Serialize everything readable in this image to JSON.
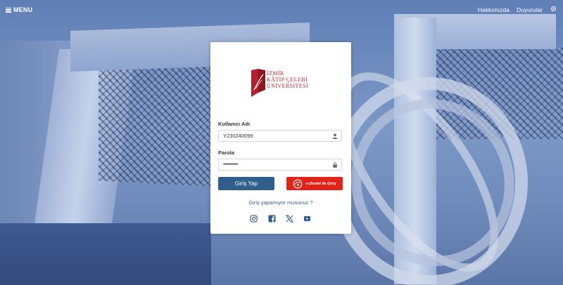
{
  "topbar": {
    "menu_label": "MENU",
    "about_label": "Hakkımızda",
    "announcements_label": "Duyurular"
  },
  "logo": {
    "line1": "İZMİR",
    "line2": "KÂTİP ÇELEBİ",
    "line3": "ÜNİVERSİTESİ"
  },
  "form": {
    "username_label": "Kullanıcı Adı",
    "username_value": "Y230240099",
    "password_label": "Parola",
    "password_value": "•••••••••••••",
    "login_button": "Giriş Yap",
    "edevlet_button": "e-Devlet ile Giriş",
    "help_link": "Giriş yapamıyor musunuz ?"
  },
  "social": [
    "instagram-icon",
    "facebook-icon",
    "x-icon",
    "youtube-icon"
  ],
  "colors": {
    "primary": "#2f5f8a",
    "edevlet_red": "#e2231a",
    "brand_red": "#b51f2e"
  }
}
